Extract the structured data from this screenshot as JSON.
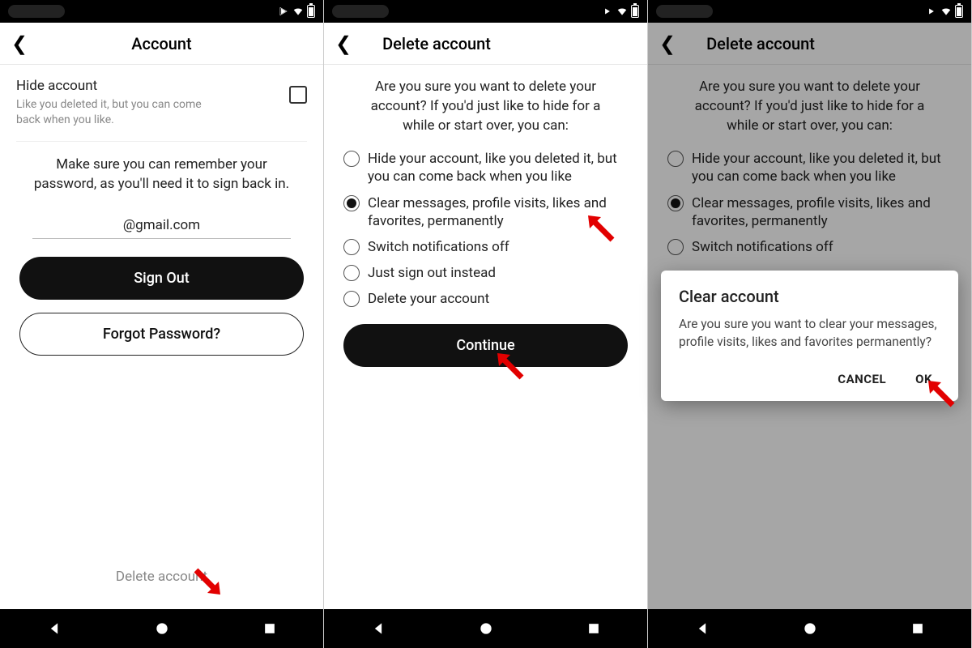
{
  "screen1": {
    "header": {
      "title": "Account"
    },
    "hide": {
      "title": "Hide account",
      "subtitle": "Like you deleted it, but you can come back when you like."
    },
    "notice": "Make sure you can remember your password, as you'll need it to sign back in.",
    "email": "@gmail.com",
    "signout_label": "Sign Out",
    "forgot_label": "Forgot Password?",
    "delete_link": "Delete account"
  },
  "screen2": {
    "header": {
      "title": "Delete account"
    },
    "prompt": "Are you sure you want to delete your account? If you'd just like to hide for a while or start over, you can:",
    "options": [
      "Hide your account, like you deleted it, but you can come back when you like",
      "Clear messages, profile visits, likes and favorites, permanently",
      "Switch notifications off",
      "Just sign out instead",
      "Delete your account"
    ],
    "continue_label": "Continue"
  },
  "screen3": {
    "header": {
      "title": "Delete account"
    },
    "prompt": "Are you sure you want to delete your account? If you'd just like to hide for a while or start over, you can:",
    "options": [
      "Hide your account, like you deleted it, but you can come back when you like",
      "Clear messages, profile visits, likes and favorites, permanently",
      "Switch notifications off"
    ],
    "dialog": {
      "title": "Clear account",
      "text": "Are you sure you want to clear your messages, profile visits, likes and favorites permanently?",
      "cancel": "CANCEL",
      "ok": "OK"
    }
  }
}
